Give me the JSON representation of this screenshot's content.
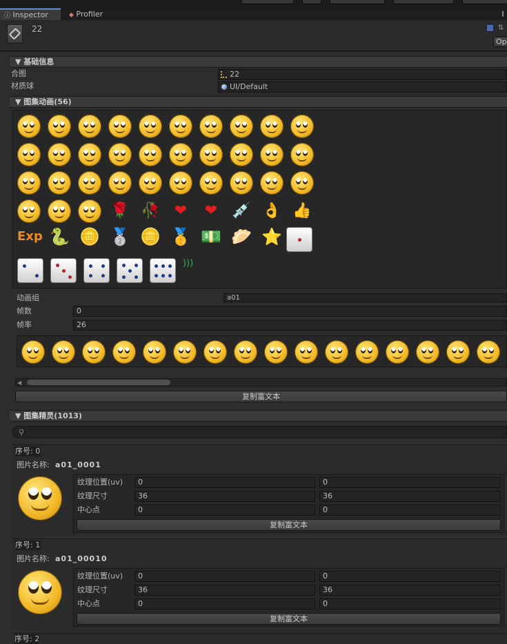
{
  "tabs": {
    "inspector": "Inspector",
    "profiler": "Profiler"
  },
  "object": {
    "name": "22",
    "open_label": "Op"
  },
  "basic": {
    "title": "▼ 基础信息",
    "atlas_label": "合图",
    "atlas_value": "22",
    "material_label": "材质球",
    "material_value": "UI/Default"
  },
  "anim": {
    "title": "▼ 图集动画(56)",
    "group_label": "动画组",
    "group_value": "a01",
    "frame_label": "帧数",
    "frame_value": "0",
    "rate_label": "帧率",
    "rate_value": "26",
    "copy": "复制富文本",
    "exp": "Exp"
  },
  "sprites": {
    "title": "▼ 图集精灵(1013)",
    "search_placeholder": "",
    "items": [
      {
        "index_label": "序号:",
        "index": "0",
        "name_label": "图片名称:",
        "name": "a01_0001",
        "uv_label": "纹理位置(uv)",
        "uv_x": "0",
        "uv_y": "0",
        "size_label": "纹理尺寸",
        "size_w": "36",
        "size_h": "36",
        "pivot_label": "中心点",
        "pivot_x": "0",
        "pivot_y": "0",
        "copy": "复制富文本"
      },
      {
        "index_label": "序号:",
        "index": "1",
        "name_label": "图片名称:",
        "name": "a01_00010",
        "uv_label": "纹理位置(uv)",
        "uv_x": "0",
        "uv_y": "0",
        "size_label": "纹理尺寸",
        "size_w": "36",
        "size_h": "36",
        "pivot_label": "中心点",
        "pivot_x": "0",
        "pivot_y": "0",
        "copy": "复制富文本"
      }
    ],
    "next_index_label": "序号:",
    "next_index": "2"
  }
}
